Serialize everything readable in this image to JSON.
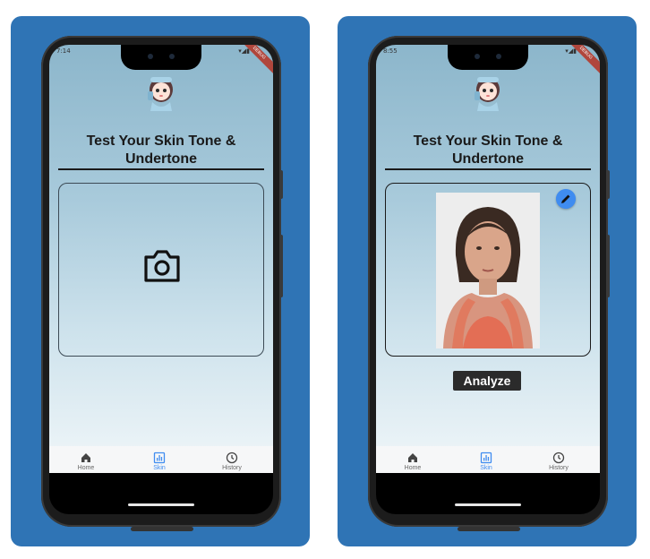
{
  "screens": [
    {
      "status_time": "7:14",
      "title": "Test Your Skin Tone & Undertone",
      "nav": [
        {
          "label": "Home",
          "icon": "home-icon"
        },
        {
          "label": "Skin",
          "icon": "chart-icon",
          "active": true
        },
        {
          "label": "History",
          "icon": "clock-icon"
        }
      ]
    },
    {
      "status_time": "8:55",
      "title": "Test Your Skin Tone & Undertone",
      "analyze_label": "Analyze",
      "nav": [
        {
          "label": "Home",
          "icon": "home-icon"
        },
        {
          "label": "Skin",
          "icon": "chart-icon",
          "active": true
        },
        {
          "label": "History",
          "icon": "clock-icon"
        }
      ]
    }
  ],
  "debug_banner": "DEBUG",
  "colors": {
    "card": "#2f74b5",
    "accent": "#3f8cf0",
    "button_dark": "#2b2b2b"
  }
}
